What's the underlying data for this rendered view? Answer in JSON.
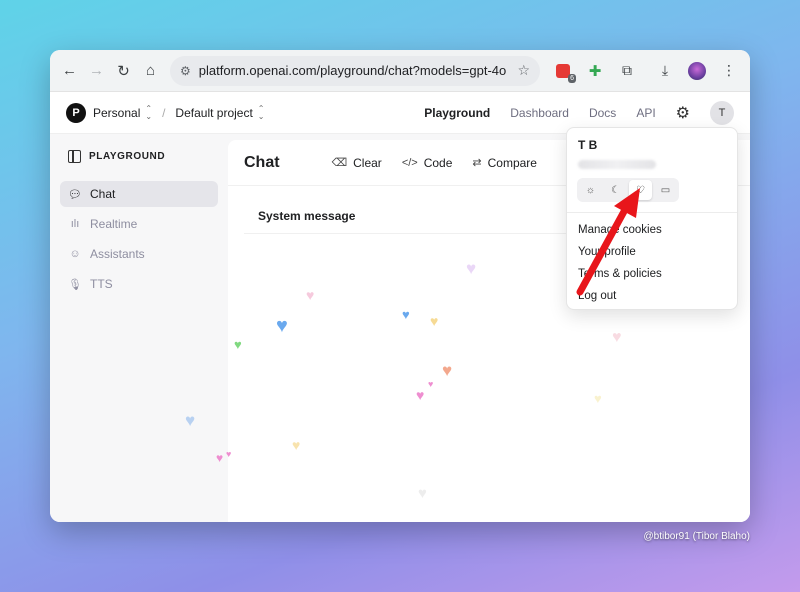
{
  "browser": {
    "url": "platform.openai.com/playground/chat?models=gpt-4o",
    "extension_badge": "6"
  },
  "header": {
    "org_initial": "P",
    "org_name": "Personal",
    "project_name": "Default project",
    "nav": {
      "playground": "Playground",
      "dashboard": "Dashboard",
      "docs": "Docs",
      "api": "API"
    },
    "user_initial": "T"
  },
  "sidebar": {
    "title": "PLAYGROUND",
    "items": [
      {
        "label": "Chat",
        "icon": "chat-bubble-icon",
        "active": true
      },
      {
        "label": "Realtime",
        "icon": "waveform-icon",
        "active": false
      },
      {
        "label": "Assistants",
        "icon": "robot-icon",
        "active": false
      },
      {
        "label": "TTS",
        "icon": "microphone-icon",
        "active": false
      }
    ]
  },
  "main": {
    "title": "Chat",
    "actions": {
      "clear": "Clear",
      "code": "Code",
      "compare": "Compare"
    },
    "system_message_label": "System message"
  },
  "dropdown": {
    "user_name": "T B",
    "theme_options": [
      "sun-icon",
      "moon-icon",
      "heart-icon",
      "monitor-icon"
    ],
    "selected_theme": "heart-icon",
    "items": [
      "Manage cookies",
      "Your profile",
      "Terms & policies",
      "Log out"
    ]
  },
  "colors": {
    "arrow": "#e8161b",
    "active_nav_bg": "#e5e5ea"
  },
  "credit": "@btibor91 (Tibor Blaho)"
}
